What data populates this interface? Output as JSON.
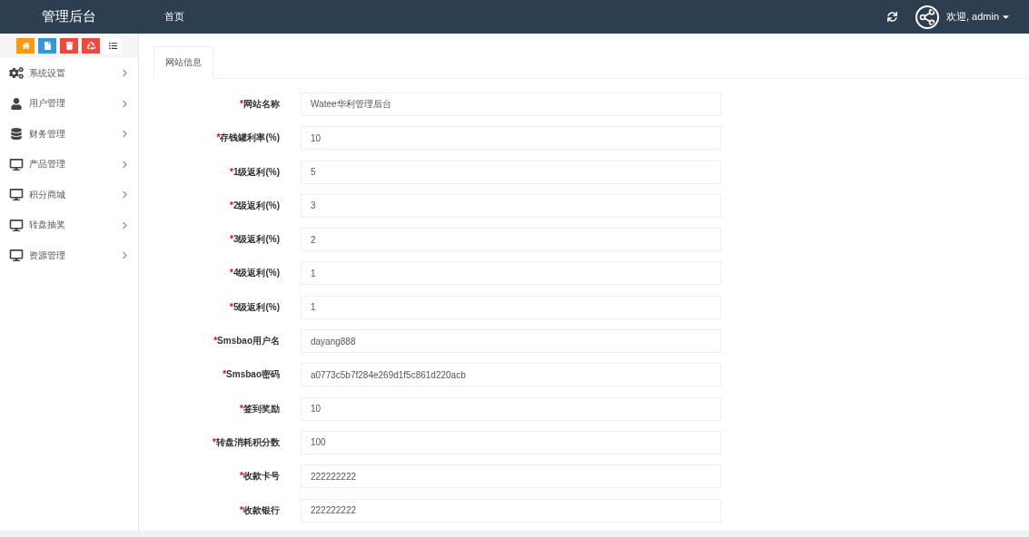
{
  "header": {
    "brand": "管理后台",
    "nav": "首页",
    "user": "欢迎, admin"
  },
  "toolbar": [
    {
      "kind": "home",
      "color": "#f39c12"
    },
    {
      "kind": "file",
      "color": "#3498db"
    },
    {
      "kind": "trash",
      "color": "#e74c3c"
    },
    {
      "kind": "recycle",
      "color": "#e74c3c"
    },
    {
      "kind": "list",
      "color": "#ffffff"
    }
  ],
  "sidebar": {
    "items": [
      {
        "label": "系统设置",
        "kind": "gears"
      },
      {
        "label": "用户管理",
        "kind": "user"
      },
      {
        "label": "财务管理",
        "kind": "database"
      },
      {
        "label": "产品管理",
        "kind": "monitor"
      },
      {
        "label": "积分商城",
        "kind": "monitor"
      },
      {
        "label": "转盘抽奖",
        "kind": "monitor"
      },
      {
        "label": "资源管理",
        "kind": "monitor"
      }
    ]
  },
  "tabs": [
    {
      "label": "网站信息",
      "selected": true
    }
  ],
  "form": {
    "fields": [
      {
        "mark": "*",
        "label": "网站名称",
        "value": "Watee华利管理后台"
      },
      {
        "mark": "*",
        "label": "存钱罐利率(%)",
        "value": "10"
      },
      {
        "mark": "*",
        "label": "1级返利(%)",
        "value": "5"
      },
      {
        "mark": "*",
        "label": "2级返利(%)",
        "value": "3"
      },
      {
        "mark": "*",
        "label": "3级返利(%)",
        "value": "2"
      },
      {
        "mark": "*",
        "label": "4级返利(%)",
        "value": "1"
      },
      {
        "mark": "*",
        "label": "5级返利(%)",
        "value": "1"
      },
      {
        "mark": "*",
        "label": "Smsbao用户名",
        "value": "dayang888"
      },
      {
        "mark": "*",
        "label": "Smsbao密码",
        "value": "a0773c5b7f284e269d1f5c861d220acb"
      },
      {
        "mark": "*",
        "label": "签到奖励",
        "value": "10"
      },
      {
        "mark": "*",
        "label": "转盘消耗积分数",
        "value": "100"
      },
      {
        "mark": "*",
        "label": "收款卡号",
        "value": "222222222"
      },
      {
        "mark": "*",
        "label": "收款银行",
        "value": "222222222"
      }
    ]
  }
}
